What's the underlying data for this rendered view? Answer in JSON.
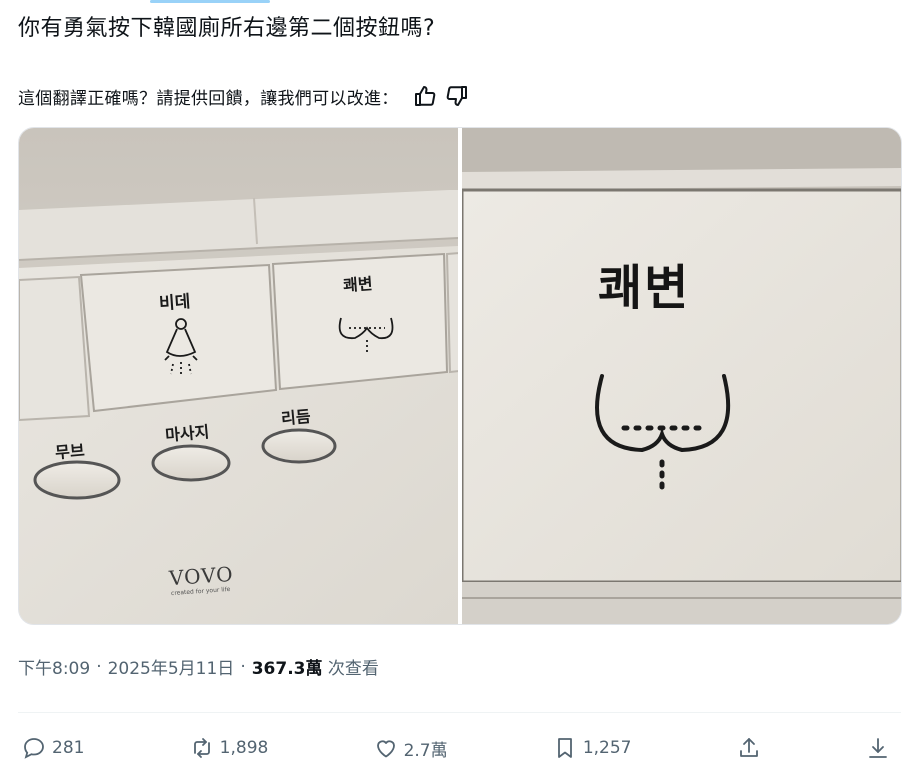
{
  "tweet": {
    "text": "你有勇氣按下韓國廁所右邊第二個按鈕嗎?"
  },
  "translation": {
    "question": "這個翻譯正確嗎？請提供回饋，讓我們可以改進："
  },
  "media": {
    "left_photo": {
      "button_labels": [
        "비데",
        "쾌변"
      ],
      "lower_button_labels": [
        "무브",
        "마사지",
        "리듬"
      ],
      "brand": "VOVO",
      "brand_tagline": "created for your life"
    },
    "right_photo": {
      "label": "쾌변"
    }
  },
  "meta": {
    "time": "下午8:09",
    "separator": "·",
    "date": "2025年5月11日",
    "views_count": "367.3萬",
    "views_label": "次查看"
  },
  "actions": {
    "replies": "281",
    "reposts": "1,898",
    "likes": "2.7萬",
    "bookmarks": "1,257"
  },
  "icons": {
    "reply": "reply-icon",
    "repost": "repost-icon",
    "like": "like-icon",
    "bookmark": "bookmark-icon",
    "share": "share-icon",
    "download": "download-icon",
    "thumbs_up": "thumbs-up-icon",
    "thumbs_down": "thumbs-down-icon"
  },
  "colors": {
    "text": "#0f1419",
    "muted": "#536471",
    "accent": "#1d9bf0"
  }
}
